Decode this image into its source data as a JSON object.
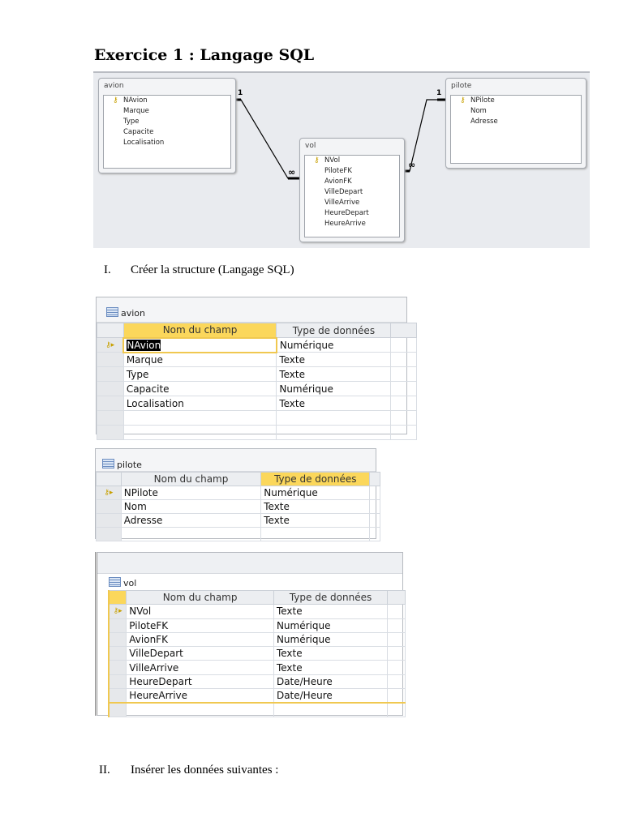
{
  "title": "Exercice 1 : Langage SQL",
  "section1": {
    "num": "I.",
    "label": "Créer la structure (Langage SQL)"
  },
  "section2": {
    "num": "II.",
    "label": "Insérer les données suivantes :"
  },
  "diagram": {
    "avion": {
      "name": "avion",
      "fields": [
        "NAvion",
        "Marque",
        "Type",
        "Capacite",
        "Localisation"
      ]
    },
    "pilote": {
      "name": "pilote",
      "fields": [
        "NPilote",
        "Nom",
        "Adresse"
      ]
    },
    "vol": {
      "name": "vol",
      "fields": [
        "NVol",
        "PiloteFK",
        "AvionFK",
        "VilleDepart",
        "VilleArrive",
        "HeureDepart",
        "HeureArrive"
      ]
    },
    "one": "1",
    "many": "∞"
  },
  "headers": {
    "field": "Nom du champ",
    "type": "Type de données"
  },
  "tables": {
    "avion": {
      "name": "avion",
      "rows": [
        [
          "NAvion",
          "Numérique"
        ],
        [
          "Marque",
          "Texte"
        ],
        [
          "Type",
          "Texte"
        ],
        [
          "Capacite",
          "Numérique"
        ],
        [
          "Localisation",
          "Texte"
        ]
      ]
    },
    "pilote": {
      "name": "pilote",
      "rows": [
        [
          "NPilote",
          "Numérique"
        ],
        [
          "Nom",
          "Texte"
        ],
        [
          "Adresse",
          "Texte"
        ]
      ]
    },
    "vol": {
      "name": "vol",
      "rows": [
        [
          "NVol",
          "Texte"
        ],
        [
          "PiloteFK",
          "Numérique"
        ],
        [
          "AvionFK",
          "Numérique"
        ],
        [
          "VilleDepart",
          "Texte"
        ],
        [
          "VilleArrive",
          "Texte"
        ],
        [
          "HeureDepart",
          "Date/Heure"
        ],
        [
          "HeureArrive",
          "Date/Heure"
        ]
      ]
    }
  }
}
